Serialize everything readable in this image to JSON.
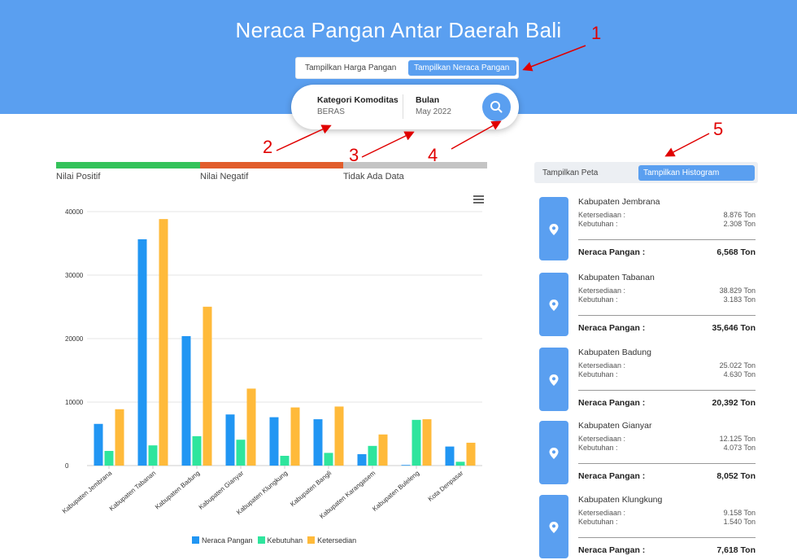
{
  "header": {
    "title": "Neraca Pangan Antar Daerah Bali",
    "toggle": {
      "option1": "Tampilkan Harga Pangan",
      "option2": "Tampilkan Neraca Pangan",
      "active": "option2"
    }
  },
  "search": {
    "category_label": "Kategori Komoditas",
    "category_value": "BERAS",
    "month_label": "Bulan",
    "month_value": "May 2022",
    "button_icon": "search-icon"
  },
  "annotations": [
    "1",
    "2",
    "3",
    "4",
    "5"
  ],
  "status_legend": [
    {
      "label": "Nilai Positif",
      "color": "#34c25a"
    },
    {
      "label": "Nilai Negatif",
      "color": "#e15d2c"
    },
    {
      "label": "Tidak Ada Data",
      "color": "#c4c4c4"
    }
  ],
  "chart_data": {
    "type": "bar",
    "categories": [
      "Kabupaten Jembrana",
      "Kabupaten Tabanan",
      "Kabupaten Badung",
      "Kabupaten Gianyar",
      "Kabupaten Klungkung",
      "Kabupaten Bangli",
      "Kabupaten Karangasem",
      "Kabupaten Buleleng",
      "Kota Denpasar"
    ],
    "series": [
      {
        "name": "Neraca Pangan",
        "color": "#2196f3",
        "values": [
          6568,
          35646,
          20392,
          8052,
          7618,
          7300,
          1800,
          100,
          3000
        ]
      },
      {
        "name": "Kebutuhan",
        "color": "#2ee59d",
        "values": [
          2308,
          3183,
          4630,
          4073,
          1540,
          2000,
          3100,
          7200,
          600
        ]
      },
      {
        "name": "Ketersedian",
        "color": "#ffba3a",
        "values": [
          8876,
          38829,
          25022,
          12125,
          9158,
          9300,
          4900,
          7300,
          3600
        ]
      }
    ],
    "yticks": [
      0,
      10000,
      20000,
      30000,
      40000
    ],
    "ylim": [
      0,
      40000
    ],
    "grid": true,
    "legend": "bottom"
  },
  "right_toggle": {
    "option1": "Tampilkan Peta",
    "option2": "Tampilkan Histogram",
    "active": "option2"
  },
  "cards": [
    {
      "name": "Kabupaten Jembrana",
      "ketersediaan_label": "Ketersediaan :",
      "ketersediaan": "8.876 Ton",
      "kebutuhan_label": "Kebutuhan :",
      "kebutuhan": "2.308 Ton",
      "neraca_label": "Neraca Pangan :",
      "neraca": "6,568 Ton"
    },
    {
      "name": "Kabupaten Tabanan",
      "ketersediaan_label": "Ketersediaan :",
      "ketersediaan": "38.829 Ton",
      "kebutuhan_label": "Kebutuhan :",
      "kebutuhan": "3.183 Ton",
      "neraca_label": "Neraca Pangan :",
      "neraca": "35,646 Ton"
    },
    {
      "name": "Kabupaten Badung",
      "ketersediaan_label": "Ketersediaan :",
      "ketersediaan": "25.022 Ton",
      "kebutuhan_label": "Kebutuhan :",
      "kebutuhan": "4.630 Ton",
      "neraca_label": "Neraca Pangan :",
      "neraca": "20,392 Ton"
    },
    {
      "name": "Kabupaten Gianyar",
      "ketersediaan_label": "Ketersediaan :",
      "ketersediaan": "12.125 Ton",
      "kebutuhan_label": "Kebutuhan :",
      "kebutuhan": "4.073 Ton",
      "neraca_label": "Neraca Pangan :",
      "neraca": "8,052 Ton"
    },
    {
      "name": "Kabupaten Klungkung",
      "ketersediaan_label": "Ketersediaan :",
      "ketersediaan": "9.158 Ton",
      "kebutuhan_label": "Kebutuhan :",
      "kebutuhan": "1.540 Ton",
      "neraca_label": "Neraca Pangan :",
      "neraca": "7,618 Ton"
    }
  ]
}
